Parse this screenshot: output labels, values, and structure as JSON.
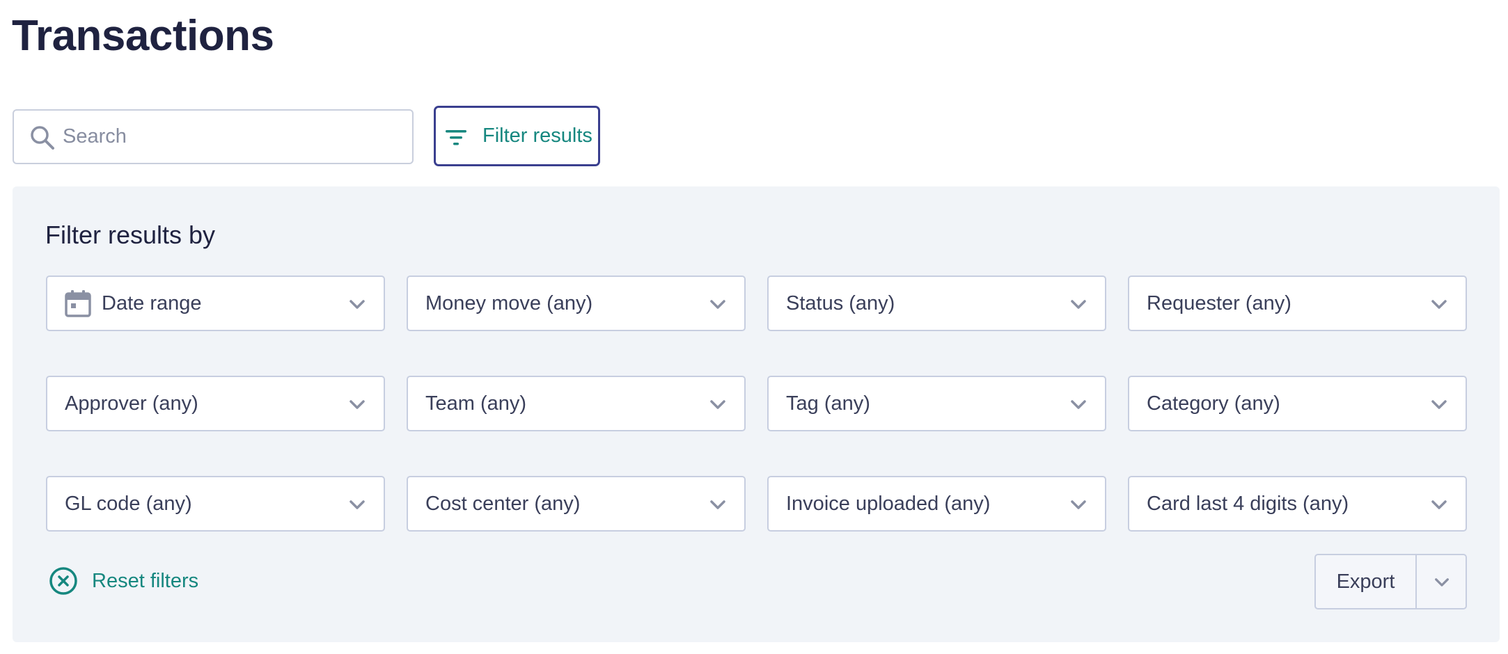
{
  "header": {
    "title": "Transactions"
  },
  "search": {
    "placeholder": "Search",
    "value": ""
  },
  "filter_button": {
    "label": "Filter results",
    "icon": "filter-icon"
  },
  "filter_panel": {
    "title": "Filter results by",
    "dropdowns": [
      {
        "label": "Date range",
        "icon": "calendar-icon"
      },
      {
        "label": "Money move (any)"
      },
      {
        "label": "Status (any)"
      },
      {
        "label": "Requester (any)"
      },
      {
        "label": "Approver (any)"
      },
      {
        "label": "Team (any)"
      },
      {
        "label": "Tag (any)"
      },
      {
        "label": "Category (any)"
      },
      {
        "label": "GL code (any)"
      },
      {
        "label": "Cost center (any)"
      },
      {
        "label": "Invoice uploaded (any)"
      },
      {
        "label": "Card last 4 digits (any)"
      }
    ],
    "reset_label": "Reset filters",
    "export_label": "Export"
  },
  "colors": {
    "accent_teal": "#16877f",
    "focus_border": "#3a3f8f",
    "panel_bg": "#f1f4f8",
    "title_text": "#1f2240"
  }
}
